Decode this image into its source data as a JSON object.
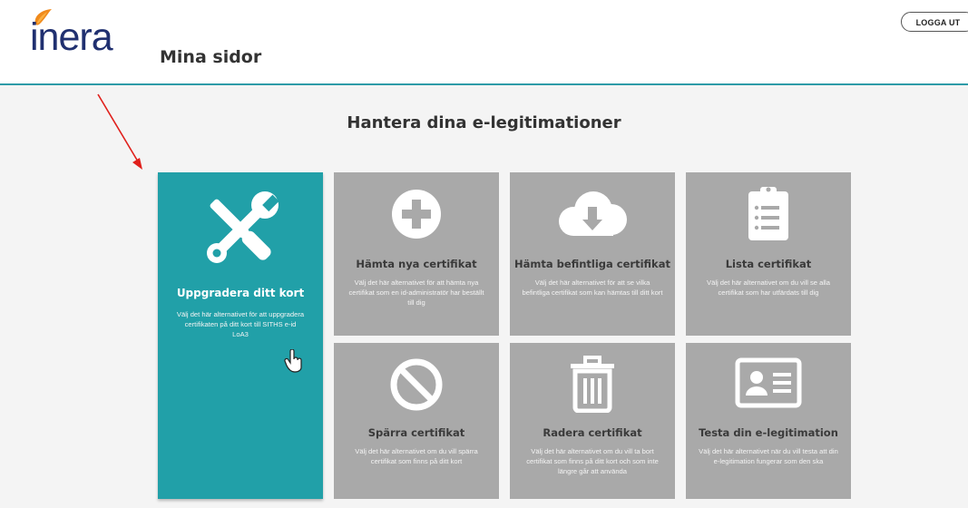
{
  "header": {
    "logo_text": "inera",
    "site_title": "Mina sidor",
    "logout_label": "LOGGA UT"
  },
  "main": {
    "heading": "Hantera dina e-legitimationer"
  },
  "tiles": [
    {
      "icon": "tools-icon",
      "title": "Uppgradera ditt kort",
      "description": "Välj det här alternativet för att uppgradera certifikaten på ditt kort till SITHS e-id LoA3",
      "active": true
    },
    {
      "icon": "plus-circle-icon",
      "title": "Hämta nya certifikat",
      "description": "Välj det här alternativet för att hämta nya certifikat som en id-administratör har beställt till dig",
      "active": false
    },
    {
      "icon": "cloud-download-icon",
      "title": "Hämta befintliga certifikat",
      "description": "Välj det här alternativet för att se vilka befintliga certifikat som kan hämtas till ditt kort",
      "active": false
    },
    {
      "icon": "clipboard-list-icon",
      "title": "Lista certifikat",
      "description": "Välj det här alternativet om du vill se alla certifikat som har utfärdats till dig",
      "active": false
    },
    {
      "icon": "ban-icon",
      "title": "Spärra certifikat",
      "description": "Välj det här alternativet om du vill spärra certifikat som finns på ditt kort",
      "active": false
    },
    {
      "icon": "trash-icon",
      "title": "Radera certifikat",
      "description": "Välj det här alternativet om du vill ta bort certifikat som finns på ditt kort och som inte längre går att använda",
      "active": false
    },
    {
      "icon": "id-card-icon",
      "title": "Testa din e-legitimation",
      "description": "Välj det här alternativet när du vill testa att din e-legitimation fungerar som den ska",
      "active": false
    }
  ],
  "colors": {
    "accent": "#21a0a8",
    "tile_gray": "#a9a9a9",
    "header_line": "#2e9ba8",
    "logo_text": "#203070",
    "logo_orange": "#f08a1c",
    "annotation_arrow": "#e0201c"
  }
}
